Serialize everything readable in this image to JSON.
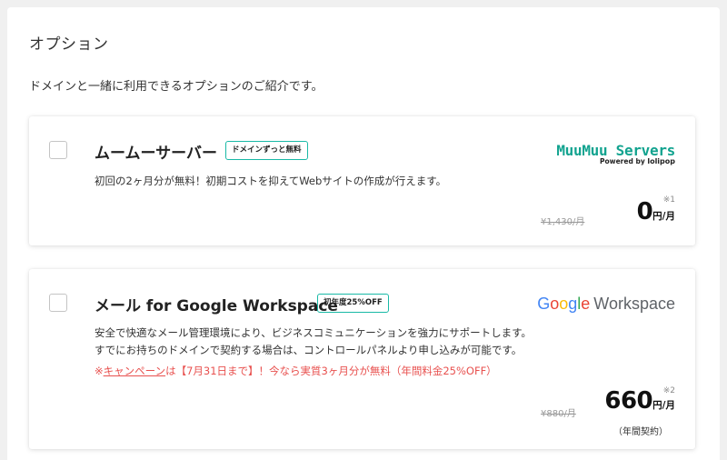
{
  "section": {
    "title": "オプション",
    "description": "ドメインと一緒に利用できるオプションのご紹介です。"
  },
  "options": [
    {
      "name": "ムームーサーバー",
      "badge": "ドメインずっと無料",
      "description": "初回の2ヶ月分が無料！初期コストを抑えてWebサイトの作成が行えます。",
      "original_price": "¥1,430/月",
      "price": "0",
      "price_unit": "円/月",
      "note": "※1",
      "logo": {
        "main": "MuuMuu Servers",
        "sub_prefix": "Powered by",
        "sub_brand": "lolipop"
      }
    },
    {
      "name": "メール for Google Workspace",
      "badge": "初年度25%OFF",
      "description_line1": "安全で快適なメール管理環境により、ビジネスコミュニケーションを強力にサポートします。",
      "description_line2": "すでにお持ちのドメインで契約する場合は、コントロールパネルより申し込みが可能です。",
      "campaign_prefix": "※",
      "campaign_link": "キャンペーン",
      "campaign_text": "は【7月31日まで】！今なら実質3ヶ月分が無料（年間料金25%OFF）",
      "original_price": "¥880/月",
      "price": "660",
      "price_unit": "円/月",
      "note": "※2",
      "annual": "（年間契約）",
      "logo": {
        "g1": "G",
        "g2": "o",
        "g3": "o",
        "g4": "g",
        "g5": "l",
        "g6": "e",
        "product": "Workspace"
      }
    }
  ],
  "colors": {
    "accent_teal": "#19b9a6",
    "campaign_red": "#e8514f",
    "muumuu_green": "#12a38f"
  }
}
